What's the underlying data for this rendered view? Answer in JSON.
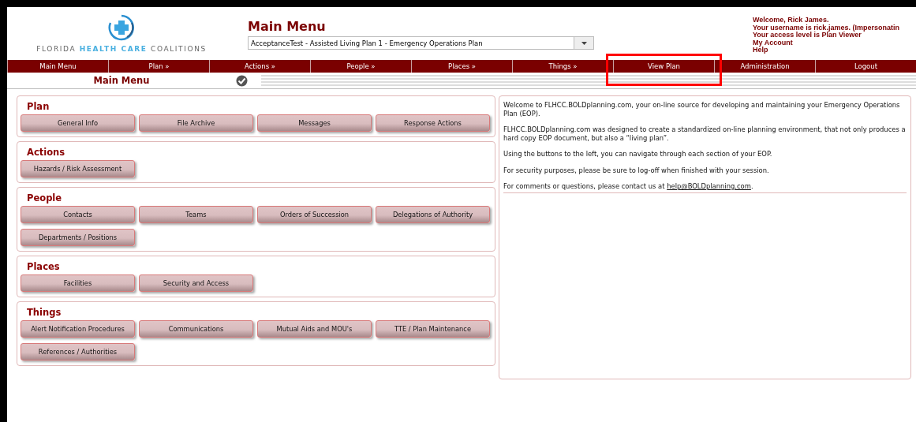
{
  "logo": {
    "text": "FLORIDA **HEALTH CARE** COALITIONS"
  },
  "header": {
    "title": "Main Menu",
    "plan_select": {
      "value": "AcceptanceTest - Assisted Living Plan 1 - Emergency Operations Plan"
    }
  },
  "user_info": [
    "Welcome, Rick James.",
    "Your username is rick.james. (Impersonatin",
    "Your access level is Plan Viewer"
  ],
  "user_links": [
    "My Account",
    "Help"
  ],
  "nav": [
    {
      "label": "Main Menu",
      "highlighted": false
    },
    {
      "label": "Plan »",
      "highlighted": false
    },
    {
      "label": "Actions »",
      "highlighted": false
    },
    {
      "label": "People »",
      "highlighted": false
    },
    {
      "label": "Places »",
      "highlighted": false
    },
    {
      "label": "Things »",
      "highlighted": false
    },
    {
      "label": "View Plan",
      "highlighted": true
    },
    {
      "label": "Administration",
      "highlighted": false
    },
    {
      "label": "Logout",
      "highlighted": false
    }
  ],
  "page_title": {
    "text": "Main Menu",
    "done": true
  },
  "sections": [
    {
      "title": "Plan",
      "buttons": [
        "General Info",
        "File Archive",
        "Messages",
        "Response Actions"
      ]
    },
    {
      "title": "Actions",
      "buttons": [
        "Hazards / Risk Assessment"
      ]
    },
    {
      "title": "People",
      "buttons": [
        "Contacts",
        "Teams",
        "Orders of Succession",
        "Delegations of Authority",
        "Departments / Positions"
      ]
    },
    {
      "title": "Places",
      "buttons": [
        "Facilities",
        "Security and Access"
      ]
    },
    {
      "title": "Things",
      "buttons": [
        "Alert Notification Procedures",
        "Communications",
        "Mutual Aids and MOU's",
        "TTE / Plan Maintenance",
        "References / Authorities"
      ]
    }
  ],
  "welcome": {
    "paragraphs": [
      "Welcome to FLHCC.BOLDplanning.com, your on-line source for developing and maintaining your Emergency Operations Plan (EOP).",
      "FLHCC.BOLDplanning.com was designed to create a standardized on-line planning environment, that not only produces a hard copy EOP document, but also a “living plan”.",
      "Using the buttons to the left, you can navigate through each section of your EOP.",
      "For security purposes, please be sure to log-off when finished with your session."
    ],
    "contact": {
      "text": "For comments or questions, please contact us at ",
      "link": "help@BOLDplanning.com",
      "after": "."
    }
  }
}
